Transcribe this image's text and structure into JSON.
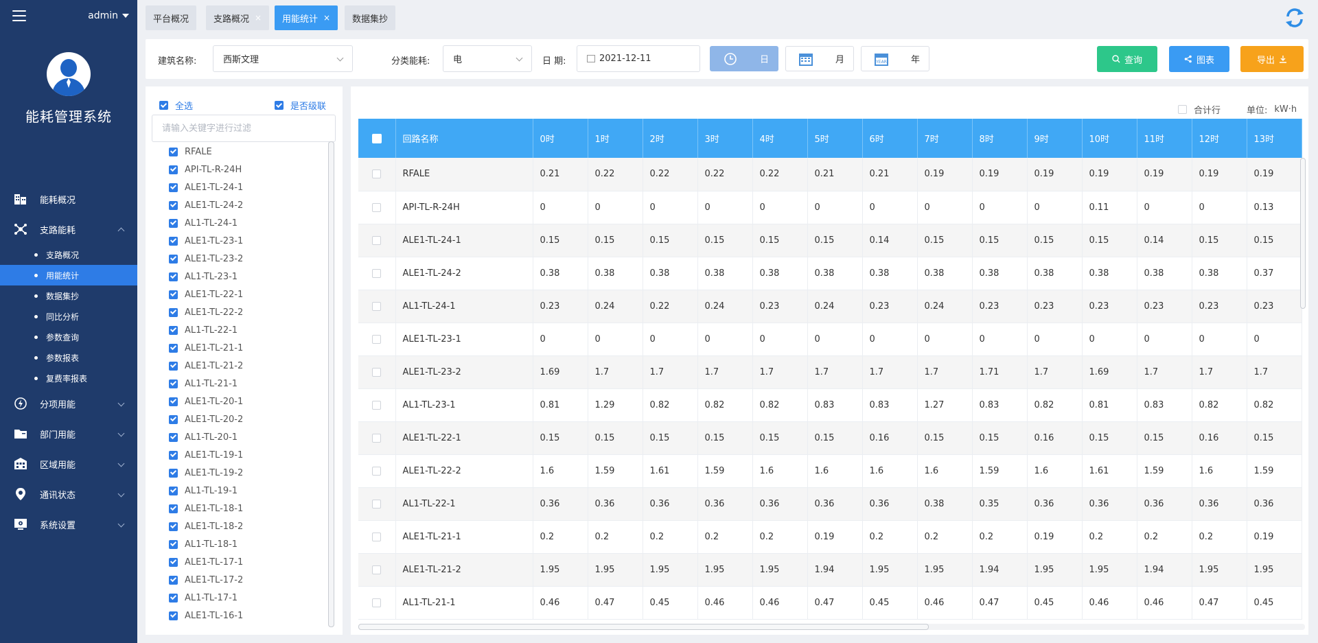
{
  "sidebar": {
    "user": "admin",
    "system_title": "能耗管理系统",
    "menu": [
      {
        "label": "能耗概况",
        "icon": "building-icon",
        "expanded": false,
        "children": []
      },
      {
        "label": "支路能耗",
        "icon": "network-icon",
        "expanded": true,
        "children": [
          {
            "label": "支路概况",
            "active": false
          },
          {
            "label": "用能统计",
            "active": true
          },
          {
            "label": "数据集抄",
            "active": false
          },
          {
            "label": "同比分析",
            "active": false
          },
          {
            "label": "参数查询",
            "active": false
          },
          {
            "label": "参数报表",
            "active": false
          },
          {
            "label": "复费率报表",
            "active": false
          }
        ]
      },
      {
        "label": "分项用能",
        "icon": "power-icon",
        "expanded": false,
        "children": []
      },
      {
        "label": "部门用能",
        "icon": "folder-icon",
        "expanded": false,
        "children": []
      },
      {
        "label": "区域用能",
        "icon": "grid-building-icon",
        "expanded": false,
        "children": []
      },
      {
        "label": "通讯状态",
        "icon": "location-pin-icon",
        "expanded": false,
        "children": []
      },
      {
        "label": "系统设置",
        "icon": "settings-monitor-icon",
        "expanded": false,
        "children": []
      }
    ]
  },
  "tabs": [
    {
      "label": "平台概况",
      "active": false,
      "closable": false
    },
    {
      "label": "支路概况",
      "active": false,
      "closable": true
    },
    {
      "label": "用能统计",
      "active": true,
      "closable": true
    },
    {
      "label": "数据集抄",
      "active": false,
      "closable": false
    }
  ],
  "filter": {
    "building_label": "建筑名称:",
    "building_value": "西斯文理",
    "category_label": "分类能耗:",
    "category_value": "电",
    "date_label": "日 期:",
    "date_value": "2021-12-11",
    "periods": [
      {
        "label": "日",
        "active": true,
        "icon": "clock-icon"
      },
      {
        "label": "月",
        "active": false,
        "icon": "calendar-icon"
      },
      {
        "label": "年",
        "active": false,
        "icon": "year-calendar-icon"
      }
    ],
    "year_icon_text": "YEAR",
    "query_label": "查询",
    "chart_label": "图表",
    "export_label": "导出",
    "colors": {
      "query": "#2dc78a",
      "chart": "#3a9bf3",
      "export": "#f7a21b",
      "accent": "#2e7ce6",
      "sidebar": "#1f3b6b",
      "header": "#40a8f5"
    }
  },
  "tree": {
    "select_all_label": "全选",
    "cascade_label": "是否级联",
    "filter_placeholder": "请输入关键字进行过滤",
    "items": [
      "RFALE",
      "API-TL-R-24H",
      "ALE1-TL-24-1",
      "ALE1-TL-24-2",
      "AL1-TL-24-1",
      "ALE1-TL-23-1",
      "ALE1-TL-23-2",
      "AL1-TL-23-1",
      "ALE1-TL-22-1",
      "ALE1-TL-22-2",
      "AL1-TL-22-1",
      "ALE1-TL-21-1",
      "ALE1-TL-21-2",
      "AL1-TL-21-1",
      "ALE1-TL-20-1",
      "ALE1-TL-20-2",
      "AL1-TL-20-1",
      "ALE1-TL-19-1",
      "ALE1-TL-19-2",
      "AL1-TL-19-1",
      "ALE1-TL-18-1",
      "ALE1-TL-18-2",
      "AL1-TL-18-1",
      "ALE1-TL-17-1",
      "ALE1-TL-17-2",
      "AL1-TL-17-1",
      "ALE1-TL-16-1"
    ]
  },
  "table": {
    "total_row_label": "合计行",
    "unit_label": "单位:",
    "unit_value": "kW·h",
    "name_header": "回路名称",
    "hour_headers": [
      "0时",
      "1时",
      "2时",
      "3时",
      "4时",
      "5时",
      "6时",
      "7时",
      "8时",
      "9时",
      "10时",
      "11时",
      "12时",
      "13时"
    ],
    "rows": [
      {
        "name": "RFALE",
        "values": [
          "0.21",
          "0.22",
          "0.22",
          "0.22",
          "0.22",
          "0.21",
          "0.21",
          "0.19",
          "0.19",
          "0.19",
          "0.19",
          "0.19",
          "0.19",
          "0.19"
        ]
      },
      {
        "name": "API-TL-R-24H",
        "values": [
          "0",
          "0",
          "0",
          "0",
          "0",
          "0",
          "0",
          "0",
          "0",
          "0",
          "0.11",
          "0",
          "0",
          "0.13"
        ]
      },
      {
        "name": "ALE1-TL-24-1",
        "values": [
          "0.15",
          "0.15",
          "0.15",
          "0.15",
          "0.15",
          "0.15",
          "0.14",
          "0.15",
          "0.15",
          "0.15",
          "0.15",
          "0.14",
          "0.15",
          "0.15"
        ]
      },
      {
        "name": "ALE1-TL-24-2",
        "values": [
          "0.38",
          "0.38",
          "0.38",
          "0.38",
          "0.38",
          "0.38",
          "0.38",
          "0.38",
          "0.38",
          "0.38",
          "0.38",
          "0.38",
          "0.38",
          "0.37"
        ]
      },
      {
        "name": "AL1-TL-24-1",
        "values": [
          "0.23",
          "0.24",
          "0.22",
          "0.24",
          "0.23",
          "0.24",
          "0.23",
          "0.24",
          "0.23",
          "0.23",
          "0.23",
          "0.23",
          "0.23",
          "0.23"
        ]
      },
      {
        "name": "ALE1-TL-23-1",
        "values": [
          "0",
          "0",
          "0",
          "0",
          "0",
          "0",
          "0",
          "0",
          "0",
          "0",
          "0",
          "0",
          "0",
          "0"
        ]
      },
      {
        "name": "ALE1-TL-23-2",
        "values": [
          "1.69",
          "1.7",
          "1.7",
          "1.7",
          "1.7",
          "1.7",
          "1.7",
          "1.7",
          "1.71",
          "1.7",
          "1.69",
          "1.7",
          "1.7",
          "1.7"
        ]
      },
      {
        "name": "AL1-TL-23-1",
        "values": [
          "0.81",
          "1.29",
          "0.82",
          "0.82",
          "0.82",
          "0.83",
          "0.83",
          "1.27",
          "0.83",
          "0.82",
          "0.81",
          "0.83",
          "0.82",
          "0.82"
        ]
      },
      {
        "name": "ALE1-TL-22-1",
        "values": [
          "0.15",
          "0.15",
          "0.15",
          "0.15",
          "0.15",
          "0.15",
          "0.16",
          "0.15",
          "0.15",
          "0.16",
          "0.15",
          "0.15",
          "0.16",
          "0.15"
        ]
      },
      {
        "name": "ALE1-TL-22-2",
        "values": [
          "1.6",
          "1.59",
          "1.61",
          "1.59",
          "1.6",
          "1.6",
          "1.6",
          "1.6",
          "1.59",
          "1.6",
          "1.61",
          "1.59",
          "1.6",
          "1.59"
        ]
      },
      {
        "name": "AL1-TL-22-1",
        "values": [
          "0.36",
          "0.36",
          "0.36",
          "0.36",
          "0.36",
          "0.36",
          "0.36",
          "0.38",
          "0.35",
          "0.36",
          "0.36",
          "0.36",
          "0.36",
          "0.36"
        ]
      },
      {
        "name": "ALE1-TL-21-1",
        "values": [
          "0.2",
          "0.2",
          "0.2",
          "0.2",
          "0.2",
          "0.19",
          "0.2",
          "0.2",
          "0.2",
          "0.19",
          "0.2",
          "0.2",
          "0.2",
          "0.19"
        ]
      },
      {
        "name": "ALE1-TL-21-2",
        "values": [
          "1.95",
          "1.95",
          "1.95",
          "1.95",
          "1.95",
          "1.94",
          "1.95",
          "1.95",
          "1.94",
          "1.95",
          "1.95",
          "1.94",
          "1.95",
          "1.95"
        ]
      },
      {
        "name": "AL1-TL-21-1",
        "values": [
          "0.46",
          "0.47",
          "0.45",
          "0.46",
          "0.46",
          "0.47",
          "0.45",
          "0.46",
          "0.47",
          "0.45",
          "0.46",
          "0.46",
          "0.47",
          "0.45"
        ]
      }
    ]
  }
}
